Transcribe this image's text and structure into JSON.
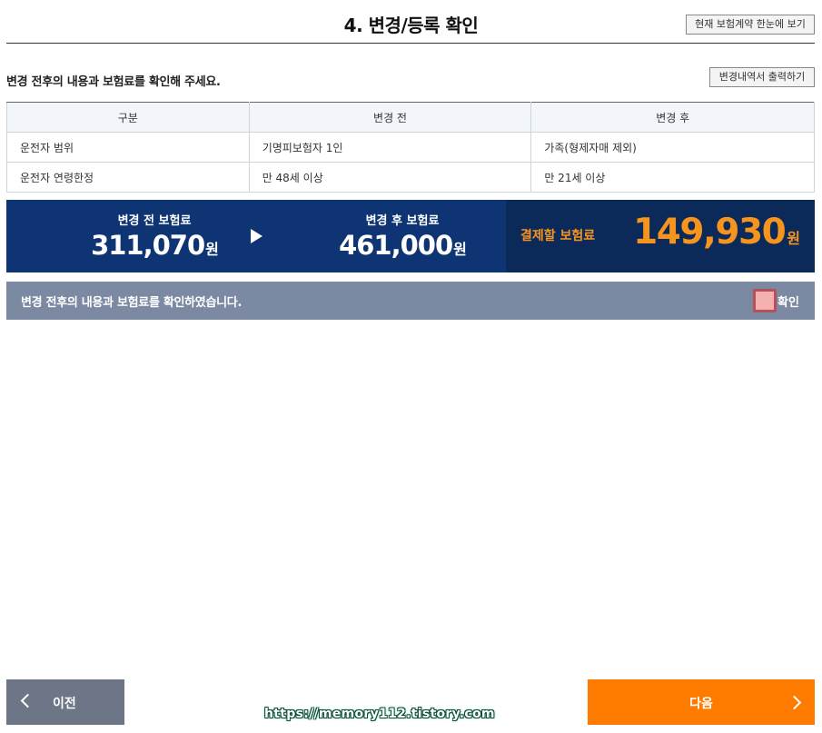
{
  "header": {
    "title": "4. 변경/등록 확인",
    "view_all_button": "현재 보험계약 한눈에 보기"
  },
  "instruction": {
    "text": "변경 전후의 내용과 보험료를 확인해 주세요.",
    "print_button": "변경내역서 출력하기"
  },
  "table": {
    "headers": [
      "구분",
      "변경 전",
      "변경 후"
    ],
    "rows": [
      [
        "운전자 범위",
        "기명피보험자 1인",
        "가족(형제자매 제외)"
      ],
      [
        "운전자 연령한정",
        "만 48세 이상",
        "만 21세 이상"
      ]
    ]
  },
  "premium": {
    "before_label": "변경 전 보험료",
    "before_amount": "311,070",
    "after_label": "변경 후 보험료",
    "after_amount": "461,000",
    "unit": "원",
    "pay_label": "결제할 보험료",
    "pay_amount": "149,930"
  },
  "confirm": {
    "text": "변경 전후의 내용과 보험료를 확인하였습니다.",
    "checkbox_label": "확인",
    "checked": false
  },
  "nav": {
    "prev_label": "이전",
    "next_label": "다음"
  },
  "watermark": "https://memory112.tistory.com",
  "colors": {
    "premium_bg": "#0e3474",
    "pay_bg": "#0b2a59",
    "accent_orange": "#f7941d",
    "next_button": "#ff7b00",
    "prev_button": "#6c7686",
    "confirm_bar": "#7c89a3"
  }
}
